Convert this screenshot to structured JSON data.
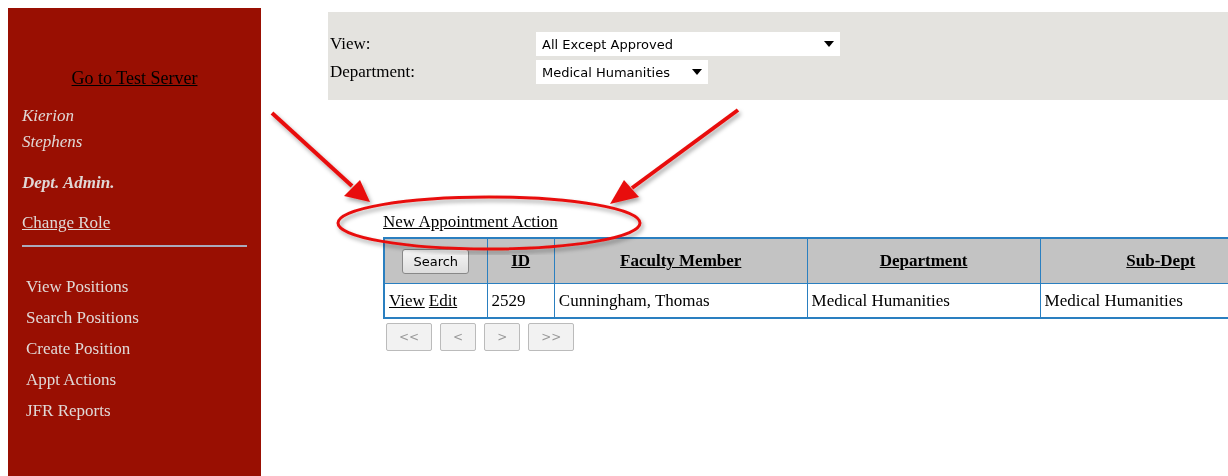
{
  "sidebar": {
    "server_link": "Go to Test Server",
    "user_name": "Kierion Stephens",
    "role": "Dept. Admin.",
    "change_role": "Change Role",
    "nav": [
      "View Positions",
      "Search Positions",
      "Create Position",
      "Appt Actions",
      "JFR Reports"
    ]
  },
  "filters": [
    {
      "label": "View:",
      "value": "All Except Approved",
      "kind": "wide"
    },
    {
      "label": "Department:",
      "value": "Medical Humanities",
      "kind": "narrow"
    }
  ],
  "new_action_link": "New Appointment Action",
  "table": {
    "search_button": "Search",
    "columns": [
      "ID",
      "Faculty Member",
      "Department",
      "Sub-Dept"
    ],
    "rows": [
      {
        "actions": [
          "View",
          "Edit"
        ],
        "cells": [
          "2529",
          "Cunningham, Thomas",
          "Medical Humanities",
          "Medical Humanities"
        ]
      }
    ]
  },
  "pager": [
    {
      "label": "<<",
      "disabled": true
    },
    {
      "label": "<",
      "disabled": true
    },
    {
      "label": ">",
      "disabled": true
    },
    {
      "label": ">>",
      "disabled": true
    }
  ]
}
